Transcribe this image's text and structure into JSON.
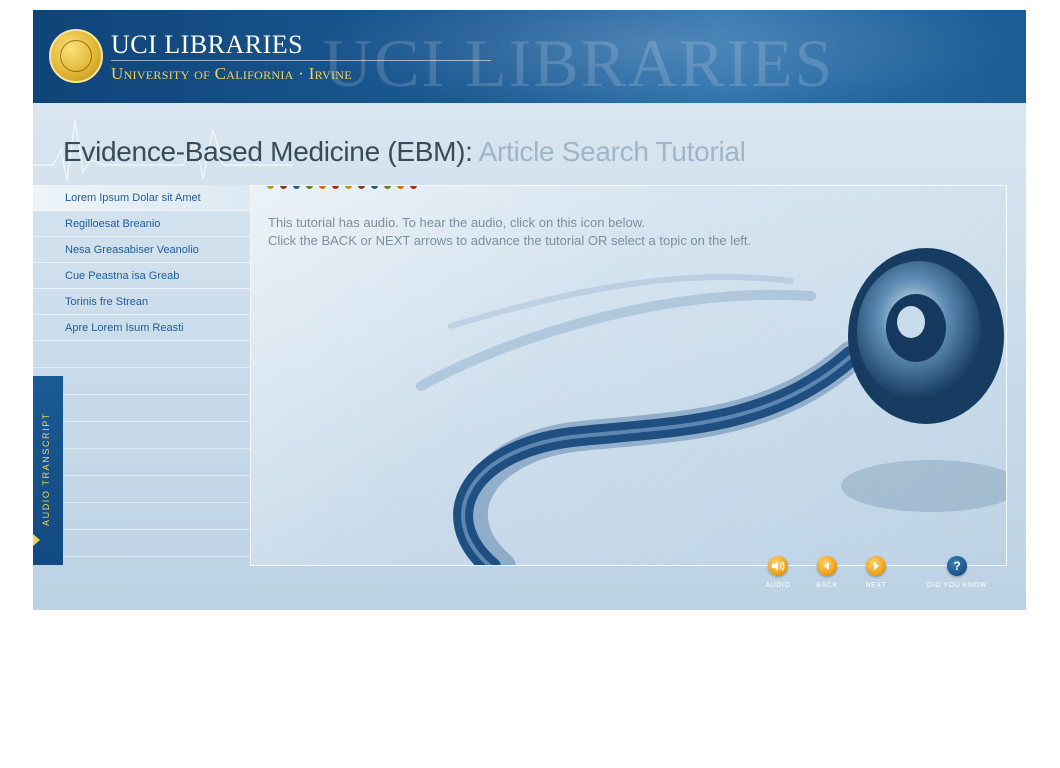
{
  "header": {
    "brand_title": "UCI LIBRARIES",
    "brand_subtitle": "University of California · Irvine",
    "watermark": "UCI LIBRARIES"
  },
  "title": {
    "main": "Evidence-Based Medicine (EBM):",
    "sub": "Article Search Tutorial"
  },
  "sidebar": {
    "items": [
      {
        "label": "Lorem Ipsum Dolar sit Amet"
      },
      {
        "label": "Regilloesat Breanio"
      },
      {
        "label": "Nesa Greasabiser Veanolio"
      },
      {
        "label": "Cue Peastna isa Greab"
      },
      {
        "label": "Torinis fre Strean"
      },
      {
        "label": "Apre Lorem Isum Reasti"
      }
    ]
  },
  "transcript_tab": {
    "label": "AUDIO TRANSCRIPT"
  },
  "content": {
    "dot_colors": [
      "#b39a1e",
      "#8b3a22",
      "#1f5d8a",
      "#6a7e1e",
      "#d06e16",
      "#9a3218",
      "#b39a1e",
      "#8b3a22",
      "#1f5d8a",
      "#6a7e1e",
      "#d06e16",
      "#9a3218"
    ],
    "intro_line1": "This tutorial has audio. To hear the audio, click on this icon below.",
    "intro_line2": "Click the BACK or NEXT arrows to advance the tutorial OR select a topic on the left."
  },
  "controls": {
    "audio": "AUDIO",
    "back": "BACK",
    "next": "NEXT",
    "did_you_know": "DID YOU KNOW"
  },
  "colors": {
    "header_blue": "#124a80",
    "accent_gold": "#f3d35a",
    "link_blue": "#1f5d9a",
    "button_orange": "#f0a31b"
  }
}
